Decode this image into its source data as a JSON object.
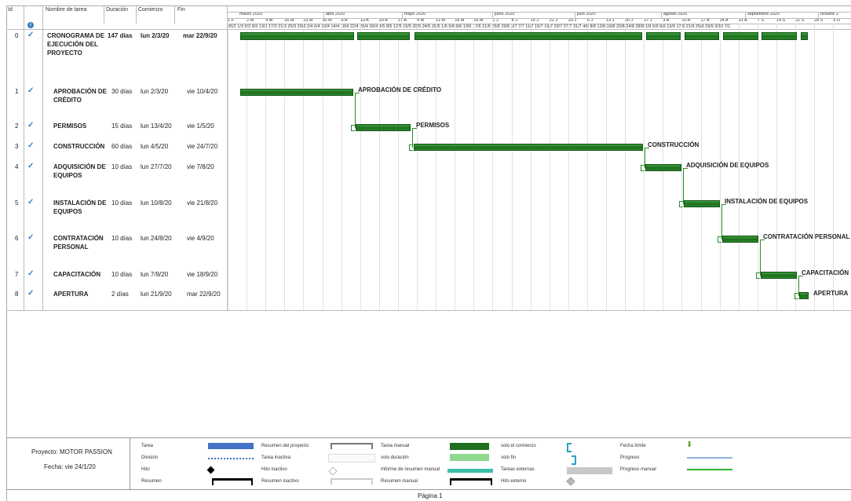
{
  "columns": {
    "id": "Id",
    "name": "Nombre de tarea",
    "duration": "Duración",
    "start": "Comienzo",
    "end": "Fin"
  },
  "months": [
    "marzo 2020",
    "abril 2020",
    "mayo 2020",
    "junio 2020",
    "julio 2020",
    "agosto 2020",
    "septiembre 2020",
    "octubre 2"
  ],
  "weeks": [
    "1 F",
    "2 M",
    "9 M",
    "16 M",
    "23 M",
    "30 M",
    "6 A",
    "13 A",
    "20 A",
    "27 A",
    "4 M",
    "11 M",
    "18 M",
    "25 M",
    "1 J",
    "8 J",
    "15 J",
    "22 J",
    "29 J",
    "6 J",
    "13 J",
    "20 J",
    "27 J",
    "3 A",
    "10 A",
    "17 A",
    "24 A",
    "31 A",
    "7 S",
    "14 S",
    "21 S",
    "28 S",
    "5 O"
  ],
  "days_row": "26/2 1/3 5/3 9/3 13/3 17/3 21/3 25/3 29/3 2/4 6/4 10/4 14/4 18/4 22/4 26/4 30/4 4/5 8/5 12/5 16/5 20/5 24/5 28/5 1/6 5/6 9/6 13/6 17/6 21/6 25/6 29/6 3/7 7/7 11/7 15/7 19/7 23/7 27/7 31/7 4/8 8/8 12/8 16/8 20/8 24/8 28/8 1/9 5/9 9/9 13/9 17/9 21/9 25/9 29/9 3/10 7/1",
  "tasks": [
    {
      "id": "0",
      "name": "CRONOGRAMA DE EJECUCIÓN DEL PROYECTO",
      "duration": "147 días",
      "start": "lun 2/3/20",
      "end": "mar 22/9/20",
      "bar_label": ""
    },
    {
      "id": "1",
      "name": "APROBACIÓN DE CRÉDITO",
      "duration": "30 días",
      "start": "lun 2/3/20",
      "end": "vie 10/4/20",
      "bar_label": "APROBACIÓN DE CRÉDITO"
    },
    {
      "id": "2",
      "name": "PERMISOS",
      "duration": "15 días",
      "start": "lun 13/4/20",
      "end": "vie 1/5/20",
      "bar_label": "PERMISOS"
    },
    {
      "id": "3",
      "name": "CONSTRUCCIÓN",
      "duration": "60 días",
      "start": "lun 4/5/20",
      "end": "vie 24/7/20",
      "bar_label": "CONSTRUCCIÓN"
    },
    {
      "id": "4",
      "name": "ADQUISICIÓN DE EQUIPOS",
      "duration": "10 días",
      "start": "lun 27/7/20",
      "end": "vie 7/8/20",
      "bar_label": "ADQUISICIÓN DE EQUIPOS"
    },
    {
      "id": "5",
      "name": "INSTALACIÓN DE EQUIPOS",
      "duration": "10 días",
      "start": "lun 10/8/20",
      "end": "vie 21/8/20",
      "bar_label": "INSTALACIÓN DE EQUIPOS"
    },
    {
      "id": "6",
      "name": "CONTRATACIÓN PERSONAL",
      "duration": "10 días",
      "start": "lun 24/8/20",
      "end": "vie 4/9/20",
      "bar_label": "CONTRATACIÓN PERSONAL"
    },
    {
      "id": "7",
      "name": "CAPACITACIÓN",
      "duration": "10 días",
      "start": "lun 7/9/20",
      "end": "vie 18/9/20",
      "bar_label": "CAPACITACIÓN"
    },
    {
      "id": "8",
      "name": "APERTURA",
      "duration": "2 días",
      "start": "lun 21/9/20",
      "end": "mar 22/9/20",
      "bar_label": "APERTURA"
    }
  ],
  "footer": {
    "project": "Proyecto: MOTOR PASSION",
    "date": "Fecha: vie 24/1/20",
    "page": "Página 1"
  },
  "legend": {
    "col1": [
      "Tarea",
      "División",
      "Hito",
      "Resumen"
    ],
    "col2": [
      "Resumen del proyecto",
      "Tarea inactiva",
      "Hito inactivo",
      "Resumen inactivo"
    ],
    "col3": [
      "Tarea manual",
      "solo duración",
      "Informe de resumen manual",
      "Resumen manual"
    ],
    "col4": [
      "solo el comienzo",
      "solo fin",
      "Tareas externas",
      "Hito externo"
    ],
    "col5": [
      "Fecha límite",
      "Progreso",
      "Progreso manual"
    ]
  },
  "colors": {
    "bar": "#2a8a2a",
    "check": "#3a7bc8",
    "task_blue": "#4472c4",
    "manual_progress": "#2bb52b"
  }
}
